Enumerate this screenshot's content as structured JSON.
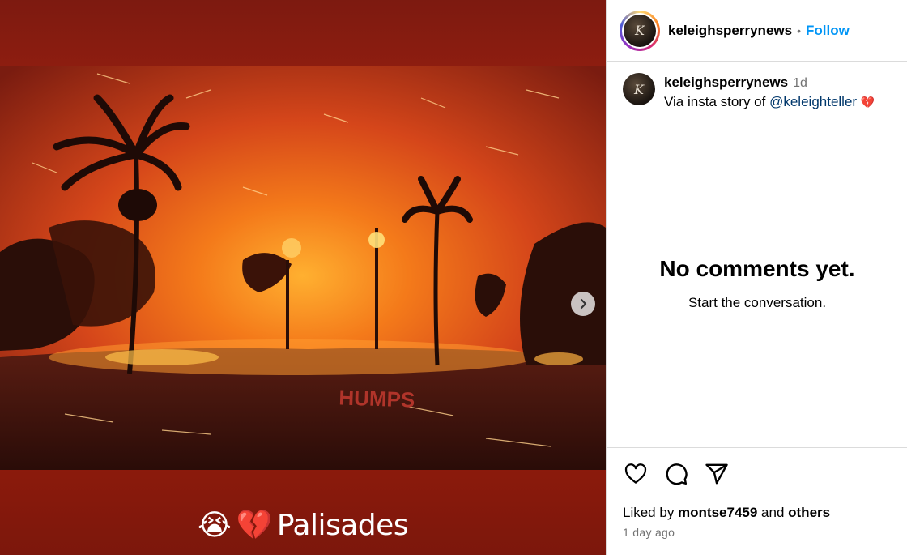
{
  "post": {
    "image_caption": "Palisades",
    "caption_emojis": [
      "😭",
      "💔"
    ],
    "street_marking": "HUMPS"
  },
  "header": {
    "username": "keleighsperrynews",
    "separator": "•",
    "follow_label": "Follow"
  },
  "caption": {
    "username": "keleighsperrynews",
    "time": "1d",
    "text_prefix": "Via insta story of ",
    "mention": "@keleighteller",
    "emoji": "💔"
  },
  "comments": {
    "empty_title": "No comments yet.",
    "empty_subtitle": "Start the conversation."
  },
  "engagement": {
    "liked_prefix": "Liked by ",
    "liked_user": "montse7459",
    "liked_mid": " and ",
    "liked_others": "others",
    "timestamp": "1 day ago"
  },
  "icons": {
    "next": "chevron-right-icon",
    "like": "heart-icon",
    "comment": "comment-icon",
    "share": "share-icon"
  },
  "colors": {
    "follow": "#0095f6",
    "mention": "#00376b",
    "muted": "#737373"
  }
}
